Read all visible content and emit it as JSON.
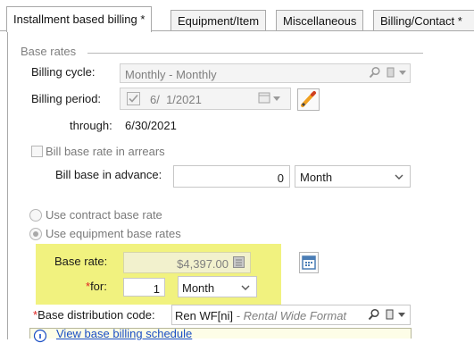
{
  "tabs": [
    {
      "label": "Installment based billing *",
      "active": true
    },
    {
      "label": "Equipment/Item",
      "active": false
    },
    {
      "label": "Miscellaneous",
      "active": false
    },
    {
      "label": "Billing/Contact *",
      "active": false
    }
  ],
  "base_rates": {
    "group_title": "Base rates",
    "billing_cycle_label": "Billing cycle:",
    "billing_cycle_value": "Monthly - Monthly",
    "billing_period_label": "Billing period:",
    "billing_period_value": "6/  1/2021",
    "through_label": "through:",
    "through_value": "6/30/2021",
    "arrears_label": "Bill base rate in arrears",
    "advance_label": "Bill base in advance:",
    "advance_value": "0",
    "advance_unit": "Month",
    "use_contract_label": "Use contract base rate",
    "use_equipment_label": "Use equipment base rates",
    "base_rate_label": "Base rate:",
    "base_rate_value": "$4,397.00",
    "for_label": "for:",
    "for_value": "1",
    "for_unit": "Month",
    "distribution_label": "Base distribution code:",
    "distribution_code": "Ren WF[ni]",
    "distribution_desc": " - Rental Wide Format",
    "schedule_link": "View base billing schedule"
  },
  "colors": {
    "highlight": "#f1f27f",
    "required": "#e0201f",
    "pencil": "#f0a020",
    "calendar_icon": "#4a7db5",
    "link": "#1a4fc4"
  },
  "icons": [
    "search-icon",
    "lookup-icon",
    "calendar-icon",
    "edit-pencil-icon",
    "calculator-icon",
    "info-icon",
    "chevron-down-icon"
  ]
}
